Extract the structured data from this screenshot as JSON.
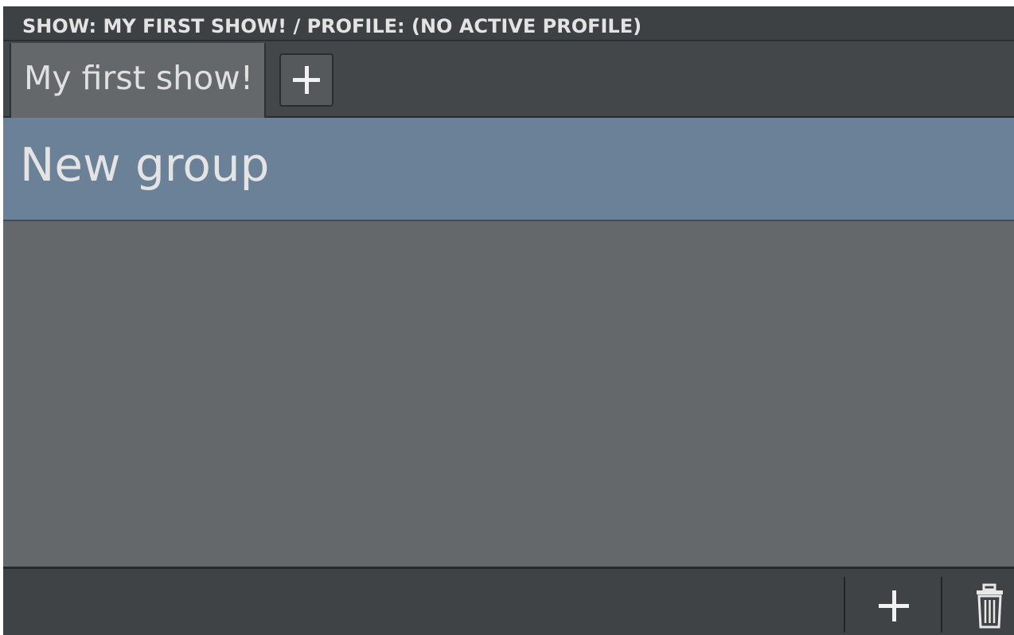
{
  "window": {
    "title": "SHOW: MY FIRST SHOW! / PROFILE: (NO ACTIVE PROFILE)"
  },
  "tabs": [
    {
      "label": "My first show!",
      "active": true
    }
  ],
  "tab_bar": {
    "add_tab_icon": "plus-icon"
  },
  "groups": [
    {
      "label": "New group",
      "selected": true
    }
  ],
  "bottom_bar": {
    "add_icon": "plus-icon",
    "delete_icon": "trash-icon"
  },
  "colors": {
    "title_bar": "#3d4144",
    "tab_bar": "#43474a",
    "active_tab": "#65686b",
    "selected_group": "#6b8198",
    "content": "#65686b",
    "bottom_bar": "#3f4346"
  }
}
